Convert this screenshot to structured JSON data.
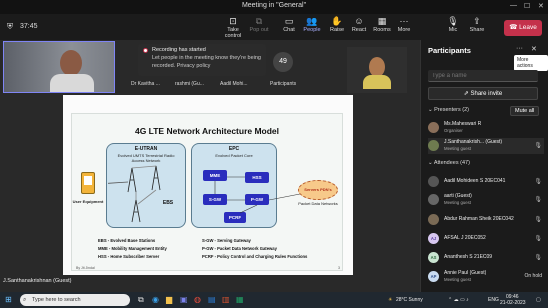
{
  "window": {
    "title": "Meeting in \"General\""
  },
  "toolbar": {
    "timer": "37:45",
    "buttons": [
      {
        "label": "Take control",
        "icon": "take-control-icon"
      },
      {
        "label": "Pop out",
        "icon": "pop-out-icon"
      },
      {
        "label": "Chat",
        "icon": "chat-icon"
      },
      {
        "label": "People",
        "icon": "people-icon"
      },
      {
        "label": "Raise",
        "icon": "raise-hand-icon"
      },
      {
        "label": "React",
        "icon": "react-icon"
      },
      {
        "label": "Rooms",
        "icon": "rooms-icon"
      },
      {
        "label": "More",
        "icon": "more-icon"
      },
      {
        "label": "Mic",
        "icon": "mic-icon"
      },
      {
        "label": "Share",
        "icon": "share-icon"
      }
    ],
    "leave_label": "Leave"
  },
  "banner": {
    "title": "Recording has started",
    "body": "Let people in the meeting know they're being recorded. Privacy policy"
  },
  "stage": {
    "names": [
      "Dr Kavitha ...",
      "rashmi (Gu...",
      "Aadil Mohi..."
    ],
    "participant_count": "49",
    "participant_label": "Participants",
    "speaker": "J.Santhanakrishnan (Guest)"
  },
  "slide": {
    "title": "4G LTE Network Architecture Model",
    "eutran_title": "E-UTRAN",
    "eutran_sub": "Evolved UMTS Terrestrial Radio Access Network",
    "epc_title": "EPC",
    "epc_sub": "Evolved Packet Core",
    "ue_label": "User Equipment",
    "ebs_label": "EBS",
    "nodes": [
      "MME",
      "HSS",
      "S-GW",
      "P-GW",
      "PCRF"
    ],
    "cloud_label": "Servers PDN's",
    "pdn_label": "Packet Data Networks",
    "legend_left": [
      "EBS - Evolved Base Stations",
      "MME - Mobility Management Entity",
      "HSS - Home Subscriber Server"
    ],
    "legend_right": [
      "S-GW - Serving Gateway",
      "P-GW - Packet Data Network Gateway",
      "PCRF - Policy Control and Charging Rules Functions"
    ],
    "footer_left": "By Jit Jindal",
    "page": "3"
  },
  "panel": {
    "title": "Participants",
    "tooltip": "More actions",
    "search_placeholder": "Type a name",
    "share_invite": "Share invite",
    "presenters_label": "Presenters (2)",
    "mute_all": "Mute all",
    "attendees_label": "Attendees (47)",
    "presenters": [
      {
        "name": "Ms.Maheswari R",
        "sub": "Organiser",
        "initials": "",
        "color": "#8a6f5a"
      },
      {
        "name": "J.Santhanakrish...  (Guest)",
        "sub": "Meeting guest",
        "initials": "",
        "color": "#6e7b4f"
      }
    ],
    "attendees": [
      {
        "name": "Aadil Mohideen S 20EC041",
        "sub": "",
        "initials": "",
        "color": "#555"
      },
      {
        "name": "aarti (Guest)",
        "sub": "Meeting guest",
        "initials": "",
        "color": "#666"
      },
      {
        "name": "Abdur Rahman Sheik 20EC042",
        "sub": "",
        "initials": "",
        "color": "#7a6a55"
      },
      {
        "name": "AFSAL J 20EC052",
        "sub": "",
        "initials": "AJ",
        "color": "#d7c7f0"
      },
      {
        "name": "Ananthesh S 21EC09",
        "sub": "",
        "initials": "AS",
        "color": "#c9e4d0"
      },
      {
        "name": "Annie Paul (Guest)",
        "sub": "Meeting guest",
        "initials": "AP",
        "color": "#c9dbf0",
        "status": "On hold"
      }
    ]
  },
  "taskbar": {
    "search": "Type here to search",
    "weather": "28°C  Sunny",
    "lang": "ENG",
    "time": "09:46",
    "date": "21-02-2023"
  },
  "colors": {
    "accent": "#7f85f5",
    "leave": "#c4314b",
    "node": "#2a2dbd"
  }
}
